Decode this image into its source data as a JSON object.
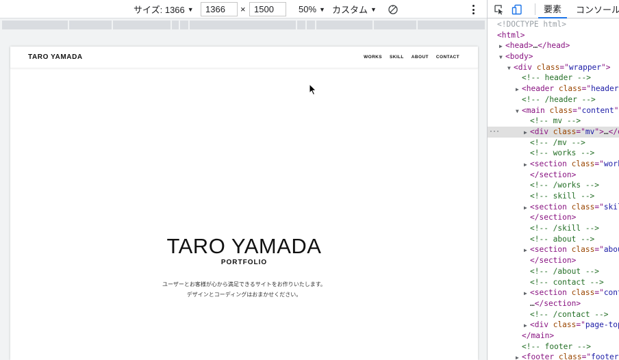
{
  "toolbar": {
    "size_label": "サイズ: 1366",
    "width_value": "1366",
    "times": "×",
    "height_value": "1500",
    "zoom": "50%",
    "throttle": "カスタム"
  },
  "site": {
    "logo": "TARO YAMADA",
    "nav": [
      "WORKS",
      "SKILL",
      "ABOUT",
      "CONTACT"
    ],
    "hero_title": "TARO YAMADA",
    "hero_subtitle": "PORTFOLIO",
    "hero_desc_1": "ユーザーとお客様が心から満足できるサイトをお作りいたします。",
    "hero_desc_2": "デザインとコーディングはおまかせください。"
  },
  "devtools": {
    "tabs": [
      "要素",
      "コンソール"
    ],
    "active_tab": "要素",
    "tree": [
      {
        "indent": 0,
        "tri": "",
        "type": "doctype",
        "text": "<!DOCTYPE html>"
      },
      {
        "indent": 0,
        "tri": "",
        "type": "open",
        "tag": "html"
      },
      {
        "indent": 1,
        "tri": "▶",
        "type": "collapsed",
        "tag": "head"
      },
      {
        "indent": 1,
        "tri": "▼",
        "type": "open",
        "tag": "body"
      },
      {
        "indent": 2,
        "tri": "▼",
        "type": "open",
        "tag": "div",
        "attr": "class",
        "val": "wrapper"
      },
      {
        "indent": 3,
        "tri": "",
        "type": "comment",
        "text": " header "
      },
      {
        "indent": 3,
        "tri": "▶",
        "type": "open",
        "tag": "header",
        "attr": "class",
        "val": "header"
      },
      {
        "indent": 3,
        "tri": "",
        "type": "comment",
        "text": " /header "
      },
      {
        "indent": 3,
        "tri": "▼",
        "type": "open",
        "tag": "main",
        "attr": "class",
        "val": "content"
      },
      {
        "indent": 4,
        "tri": "",
        "type": "comment",
        "text": " mv "
      },
      {
        "indent": 4,
        "tri": "▶",
        "type": "collapsed",
        "tag": "div",
        "attr": "class",
        "val": "mv",
        "selected": true
      },
      {
        "indent": 4,
        "tri": "",
        "type": "comment",
        "text": " /mv "
      },
      {
        "indent": 4,
        "tri": "",
        "type": "comment",
        "text": " works "
      },
      {
        "indent": 4,
        "tri": "▶",
        "type": "open",
        "tag": "section",
        "attr": "class",
        "val": "works"
      },
      {
        "indent": 4,
        "tri": "",
        "type": "close",
        "tag": "section"
      },
      {
        "indent": 4,
        "tri": "",
        "type": "comment",
        "text": " /works "
      },
      {
        "indent": 4,
        "tri": "",
        "type": "comment",
        "text": " skill "
      },
      {
        "indent": 4,
        "tri": "▶",
        "type": "open",
        "tag": "section",
        "attr": "class",
        "val": "skill"
      },
      {
        "indent": 4,
        "tri": "",
        "type": "close",
        "tag": "section"
      },
      {
        "indent": 4,
        "tri": "",
        "type": "comment",
        "text": " /skill "
      },
      {
        "indent": 4,
        "tri": "",
        "type": "comment",
        "text": " about "
      },
      {
        "indent": 4,
        "tri": "▶",
        "type": "open",
        "tag": "section",
        "attr": "class",
        "val": "about"
      },
      {
        "indent": 4,
        "tri": "",
        "type": "close",
        "tag": "section"
      },
      {
        "indent": 4,
        "tri": "",
        "type": "comment",
        "text": " /about "
      },
      {
        "indent": 4,
        "tri": "",
        "type": "comment",
        "text": " contact "
      },
      {
        "indent": 4,
        "tri": "▶",
        "type": "open",
        "tag": "section",
        "attr": "class",
        "val": "contact"
      },
      {
        "indent": 4,
        "tri": "",
        "type": "close",
        "tag": "section",
        "prefix": "…"
      },
      {
        "indent": 4,
        "tri": "",
        "type": "comment",
        "text": " /contact "
      },
      {
        "indent": 4,
        "tri": "▶",
        "type": "open",
        "tag": "div",
        "attr": "class",
        "val": "page-top"
      },
      {
        "indent": 3,
        "tri": "",
        "type": "close",
        "tag": "main"
      },
      {
        "indent": 3,
        "tri": "",
        "type": "comment",
        "text": " footer "
      },
      {
        "indent": 3,
        "tri": "▶",
        "type": "open",
        "tag": "footer",
        "attr": "class",
        "val": "footer"
      }
    ]
  },
  "colors": {
    "accent": "#1a73e8",
    "comment": "#236e25",
    "tag": "#881280",
    "attr": "#994500",
    "value": "#1a1aa6",
    "selected_row": "#e0e0e0"
  },
  "icons": [
    "caret-down-icon",
    "rotate-icon",
    "more-vert-icon",
    "inspect-icon",
    "device-toggle-icon",
    "mouse-cursor-icon"
  ]
}
